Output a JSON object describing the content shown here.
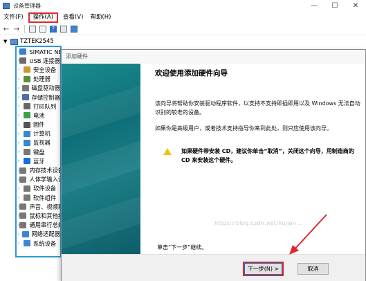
{
  "window": {
    "title": "设备管理器",
    "minimize": "—",
    "maximize": "☐",
    "close": "✕"
  },
  "menu": {
    "file": "文件(F)",
    "action": "操作(A)",
    "view": "查看(V)",
    "help": "帮助(H)"
  },
  "tree": {
    "root": "TZTEK2545",
    "items": [
      {
        "label": "SIMATIC NET",
        "icon": "simatic-icon",
        "color": "#3a7fc9"
      },
      {
        "label": "USB 连接器管理器",
        "icon": "usb-icon",
        "color": "#6b6b6b"
      },
      {
        "label": "安全设备",
        "icon": "security-icon",
        "color": "#c89b2a"
      },
      {
        "label": "处理器",
        "icon": "cpu-icon",
        "color": "#5a8f3a"
      },
      {
        "label": "磁盘驱动器",
        "icon": "disk-icon",
        "color": "#777777"
      },
      {
        "label": "存储控制器",
        "icon": "storage-icon",
        "color": "#4d6fa8"
      },
      {
        "label": "打印队列",
        "icon": "printer-icon",
        "color": "#666666"
      },
      {
        "label": "电池",
        "icon": "battery-icon",
        "color": "#3aa04a"
      },
      {
        "label": "固件",
        "icon": "firmware-icon",
        "color": "#555555"
      },
      {
        "label": "计算机",
        "icon": "computer-icon",
        "color": "#3a86d0"
      },
      {
        "label": "监视器",
        "icon": "monitor-icon",
        "color": "#3a86d0"
      },
      {
        "label": "键盘",
        "icon": "keyboard-icon",
        "color": "#777777"
      },
      {
        "label": "蓝牙",
        "icon": "bluetooth-icon",
        "color": "#1a6fd6"
      },
      {
        "label": "内存技术设备",
        "icon": "memory-icon",
        "color": "#777777"
      },
      {
        "label": "人体学输入设备",
        "icon": "hid-icon",
        "color": "#777777"
      },
      {
        "label": "软件设备",
        "icon": "software-device-icon",
        "color": "#777777"
      },
      {
        "label": "软件组件",
        "icon": "software-component-icon",
        "color": "#777777"
      },
      {
        "label": "声音、视频和游戏控制器",
        "icon": "sound-icon",
        "color": "#777777"
      },
      {
        "label": "鼠标和其他指针设备",
        "icon": "mouse-icon",
        "color": "#777777"
      },
      {
        "label": "通用串行总线控制器",
        "icon": "usb-controller-icon",
        "color": "#777777"
      },
      {
        "label": "网络适配器",
        "icon": "network-icon",
        "color": "#3a86d0"
      },
      {
        "label": "系统设备",
        "icon": "system-icon",
        "color": "#3a86d0"
      }
    ]
  },
  "wizard": {
    "title": "添加硬件",
    "heading": "欢迎使用添加硬件向导",
    "p1": "该向导将帮助你安装驱动程序软件，以支持不支持即插即用以及 Windows 无法自动识别的较老的设备。",
    "p2": "如果你是高级用户，或者技术支持指导你来到此处，则只应使用该向导。",
    "warning": "如果硬件带安装 CD，建议你单击“取消”，关闭这个向导，用制造商的 CD 来安装这个硬件。",
    "footer": "单击“下一步”继续。",
    "next": "下一步(N) >",
    "cancel": "取消",
    "watermark": "https://blog.csdn.net/liujian..."
  }
}
